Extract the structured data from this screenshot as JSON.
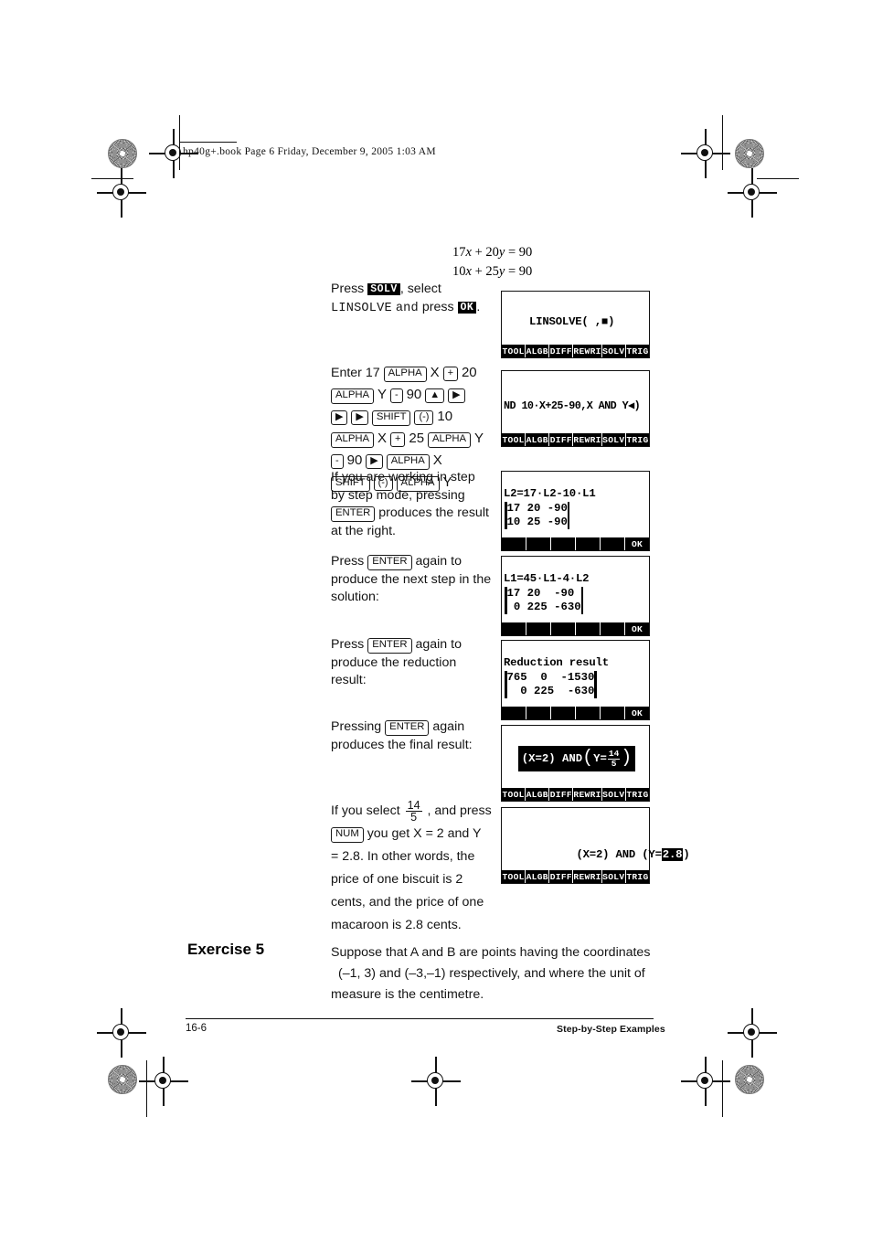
{
  "header": {
    "slug": "hp40g+.book  Page 6  Friday, December 9, 2005  1:03 AM"
  },
  "equations": {
    "line1_pre": "17",
    "line1_x": "x",
    "line1_mid": " + 20",
    "line1_y": "y",
    "line1_post": " = 90",
    "line2_pre": "10",
    "line2_x": "x",
    "line2_mid": " + 25",
    "line2_y": "y",
    "line2_post": " = 90"
  },
  "steps": {
    "press_label": "Press",
    "solv_key": "SOLV",
    "select_label": ", select",
    "linsolve_label": "LINSOLVE",
    "and_label": "and",
    "press2_label": "press",
    "ok_key": "OK",
    "period": ".",
    "enter_intro": "Enter 17",
    "alpha": "ALPHA",
    "shift": "SHIFT",
    "enter": "ENTER",
    "num": "NUM",
    "neg": "(-)",
    "plus": "+",
    "minus": "-",
    "up_arrow": "▲",
    "right_arrow": "▶",
    "var_x": "X",
    "var_y": "Y",
    "n20": "20",
    "n90": "90",
    "n10": "10",
    "n25": "25",
    "p3_line1": "If you are working in step",
    "p3_line2": "by step mode, pressing",
    "p3_line3": "produces the result",
    "p3_line4": "at the right.",
    "p4_press": "Press",
    "p4_again": "again to",
    "p4_line2": "produce the next step in the",
    "p4_line3": "solution:",
    "p5_press": "Press",
    "p5_again": "again to",
    "p5_line2": "produce the reduction",
    "p5_line3": "result:",
    "p6_press": "Pressing",
    "p6_again": "again",
    "p6_line2": "produces the final result:",
    "p7_a": "If you select",
    "p7_frac_n": "14",
    "p7_frac_d": "5",
    "p7_b": ", and press",
    "p7_c": "you get X = 2 and Y",
    "p7_d": "= 2.8. In other words, the",
    "p7_e": "price of one biscuit is 2",
    "p7_f": "cents, and the price of one",
    "p7_g": "macaroon is 2.8 cents."
  },
  "softkeys": {
    "main": [
      "TOOL",
      "ALGB",
      "DIFF",
      "REWRI",
      "SOLV",
      "TRIG"
    ],
    "ok": "OK"
  },
  "screens": {
    "s1": {
      "text": "LINSOLVE( ,■)"
    },
    "s2": {
      "text": "ND 10·X+25-90,X AND Y◀)"
    },
    "s3": {
      "title": "L2=17·L2-10·L1",
      "rows": [
        "17 20 -90",
        "10 25 -90"
      ]
    },
    "s4": {
      "title": "L1=45·L1-4·L2",
      "rows": [
        "17 20  -90",
        " 0 225 -630"
      ]
    },
    "s5": {
      "title": "Reduction result",
      "rows": [
        "765  0  -1530",
        "  0 225  -630"
      ]
    },
    "s6": {
      "pre": "(X=2) AND ",
      "y_label": "Y=",
      "frac_n": "14",
      "frac_d": "5"
    },
    "s7": {
      "pre": "(X=2) AND (Y=",
      "value": "2.8",
      "post": ")"
    }
  },
  "exercise": {
    "title": "Exercise 5",
    "line1": "Suppose that A and B are points having the coordinates",
    "line2": "(–1, 3) and (–3,–1) respectively, and where the unit of",
    "line3": "measure is the centimetre."
  },
  "footer": {
    "page": "16-6",
    "section": "Step-by-Step Examples"
  }
}
